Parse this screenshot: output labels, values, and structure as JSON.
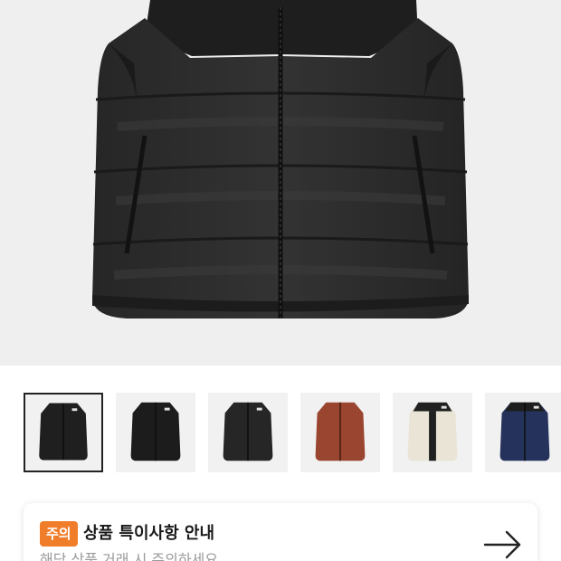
{
  "product": {
    "main_image": "black puffer vest",
    "thumbnails": [
      {
        "name": "thumb-black-1",
        "color": "#1f1f1f",
        "accent": "#1f1f1f",
        "selected": true
      },
      {
        "name": "thumb-black-2",
        "color": "#1c1c1c",
        "accent": "#1c1c1c",
        "selected": false
      },
      {
        "name": "thumb-black-3",
        "color": "#262626",
        "accent": "#262626",
        "selected": false
      },
      {
        "name": "thumb-brown",
        "color": "#9a4530",
        "accent": "#2a2a2a",
        "selected": false
      },
      {
        "name": "thumb-cream",
        "color": "#e9e4d6",
        "accent": "#202020",
        "selected": false
      },
      {
        "name": "thumb-navy",
        "color": "#25335c",
        "accent": "#1d1d1d",
        "selected": false
      }
    ]
  },
  "notice": {
    "badge": "주의",
    "title": "상품 특이사항 안내",
    "subtitle": "해당 상품 거래 시 주의하세요",
    "icon": "arrow-right-icon"
  },
  "colors": {
    "accent": "#f07d2a",
    "hero_bg": "#efefef"
  }
}
